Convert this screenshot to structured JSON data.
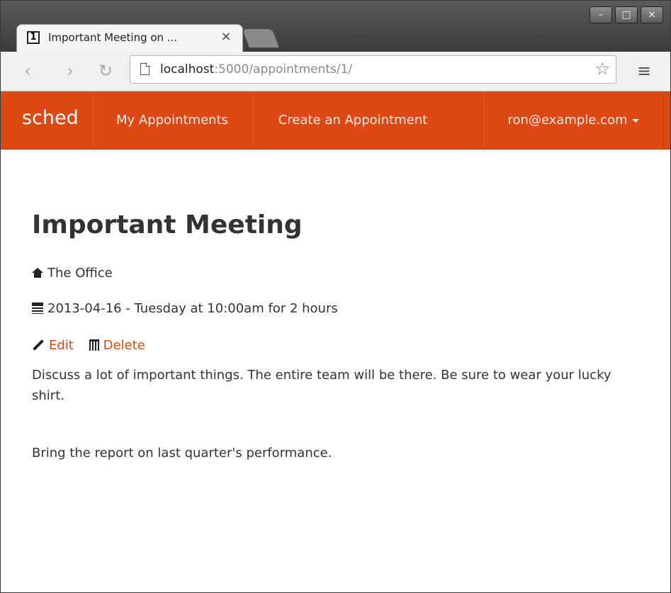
{
  "browser": {
    "tab_favicon_text": "1",
    "tab_title": "Important Meeting on ...",
    "tab_close": "×",
    "window_controls": {
      "minimize": "–",
      "maximize": "□",
      "close": "×"
    },
    "nav": {
      "back": "‹",
      "forward": "›",
      "reload": "↻"
    },
    "url": {
      "host": "localhost",
      "path": ":5000/appointments/1/"
    },
    "star": "☆",
    "menu": "≡"
  },
  "navbar": {
    "brand": "sched",
    "items": [
      {
        "label": "My Appointments"
      },
      {
        "label": "Create an Appointment"
      }
    ],
    "user_menu": "ron@example.com",
    "accent": "#dd4814"
  },
  "appointment": {
    "title": "Important Meeting",
    "location": "The Office",
    "when": "2013-04-16 - Tuesday at 10:00am for 2 hours",
    "edit_label": "Edit",
    "delete_label": "Delete",
    "description": [
      "Discuss a lot of important things. The entire team will be there. Be sure to wear your lucky shirt.",
      "Bring the report on last quarter's performance."
    ]
  },
  "icons": {
    "location": "home-icon",
    "date": "calendar-icon",
    "edit": "pencil-icon",
    "delete": "trash-icon"
  }
}
